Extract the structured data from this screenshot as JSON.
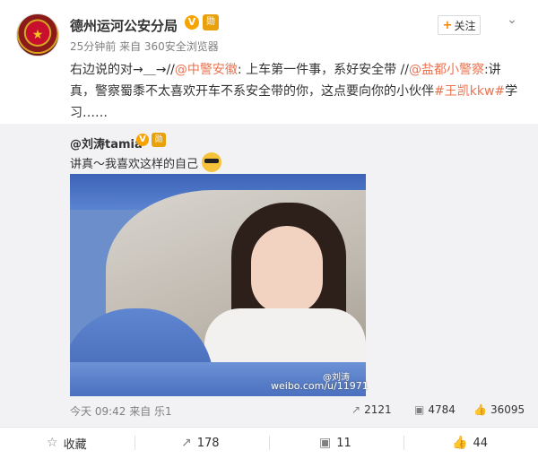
{
  "post": {
    "author": "德州运河公安分局",
    "verified_badge": "V",
    "medal": "勋",
    "meta": "25分钟前 来自 360安全浏览器",
    "follow_label": "关注",
    "text_parts": [
      "右边说的对→＿→//",
      "@中警安徽",
      ": 上车第一件事，系好安全带 //",
      "@盐都小警察",
      ":讲真，警察蜀黍不太喜欢开车不系安全带的你，这点要向你的小伙伴",
      "#王凯kkw#",
      "学习……"
    ]
  },
  "repost": {
    "author": "@刘涛tamia",
    "verified_badge": "V",
    "medal": "勋",
    "text": "讲真～我喜欢这样的自己",
    "emoji": "sunglasses-emoji",
    "watermark_url": "weibo.com/u/11971",
    "watermark_name": "@刘涛",
    "footer": "今天 09:42 来自 乐1",
    "reposts": "2121",
    "comments": "4784",
    "likes": "36095"
  },
  "actions": {
    "favorite": "收藏",
    "repost": "178",
    "comment": "11",
    "like": "44"
  },
  "colors": {
    "link": "#eb7350",
    "accent": "#ff8200",
    "repost_bg": "#f2f2f5"
  }
}
